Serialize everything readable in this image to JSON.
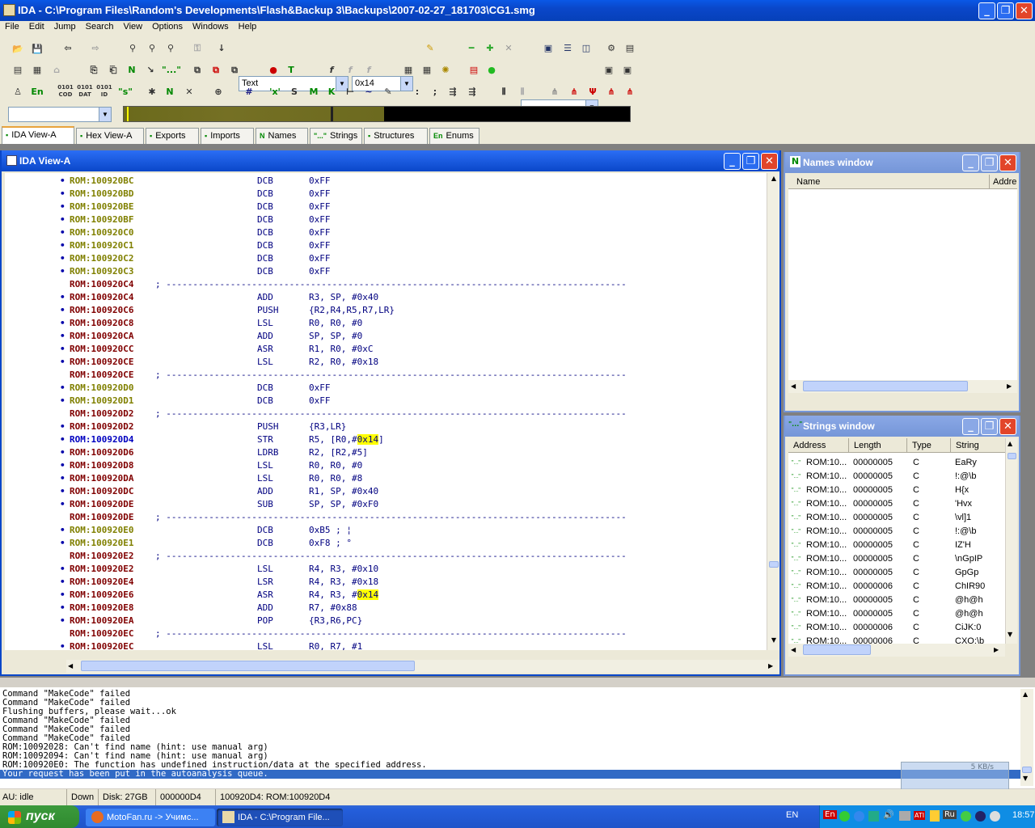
{
  "window": {
    "title": "IDA - C:\\Program Files\\Random's Developments\\Flash&Backup 3\\Backups\\2007-02-27_181703\\CG1.smg"
  },
  "menu": [
    "File",
    "Edit",
    "Jump",
    "Search",
    "View",
    "Options",
    "Windows",
    "Help"
  ],
  "toolbar": {
    "segment_type": "Text",
    "value_combo": "0x14",
    "row3": [
      "0101 COD",
      "0101 DAT",
      "0101 ID"
    ],
    "en_label": "En"
  },
  "tabs": [
    {
      "label": "IDA View-A",
      "icon": "ida-view-icon"
    },
    {
      "label": "Hex View-A",
      "icon": "hex-icon"
    },
    {
      "label": "Exports",
      "icon": "exports-icon"
    },
    {
      "label": "Imports",
      "icon": "imports-icon"
    },
    {
      "label": "Names",
      "icon": "N"
    },
    {
      "label": "Strings",
      "icon": "\"...\""
    },
    {
      "label": "Structures",
      "icon": "structures-icon"
    },
    {
      "label": "Enums",
      "icon": "En"
    }
  ],
  "ida_view": {
    "title": "IDA View-A",
    "lines": [
      {
        "addr": "ROM:100920BC",
        "color": "#808000",
        "dot": true,
        "mn": "DCB",
        "op": "0xFF"
      },
      {
        "addr": "ROM:100920BD",
        "color": "#808000",
        "dot": true,
        "mn": "DCB",
        "op": "0xFF"
      },
      {
        "addr": "ROM:100920BE",
        "color": "#808000",
        "dot": true,
        "mn": "DCB",
        "op": "0xFF"
      },
      {
        "addr": "ROM:100920BF",
        "color": "#808000",
        "dot": true,
        "mn": "DCB",
        "op": "0xFF"
      },
      {
        "addr": "ROM:100920C0",
        "color": "#808000",
        "dot": true,
        "mn": "DCB",
        "op": "0xFF"
      },
      {
        "addr": "ROM:100920C1",
        "color": "#808000",
        "dot": true,
        "mn": "DCB",
        "op": "0xFF"
      },
      {
        "addr": "ROM:100920C2",
        "color": "#808000",
        "dot": true,
        "mn": "DCB",
        "op": "0xFF"
      },
      {
        "addr": "ROM:100920C3",
        "color": "#808000",
        "dot": true,
        "mn": "DCB",
        "op": "0xFF"
      },
      {
        "addr": "ROM:100920C4",
        "color": "#800000",
        "sep": true
      },
      {
        "addr": "ROM:100920C4",
        "color": "#800000",
        "dot": true,
        "mn": "ADD",
        "op": "R3, SP, #0x40"
      },
      {
        "addr": "ROM:100920C6",
        "color": "#800000",
        "dot": true,
        "mn": "PUSH",
        "op": "{R2,R4,R5,R7,LR}"
      },
      {
        "addr": "ROM:100920C8",
        "color": "#800000",
        "dot": true,
        "mn": "LSL",
        "op": "R0, R0, #0"
      },
      {
        "addr": "ROM:100920CA",
        "color": "#800000",
        "dot": true,
        "mn": "ADD",
        "op": "SP, SP, #0"
      },
      {
        "addr": "ROM:100920CC",
        "color": "#800000",
        "dot": true,
        "mn": "ASR",
        "op": "R1, R0, #0xC"
      },
      {
        "addr": "ROM:100920CE",
        "color": "#800000",
        "dot": true,
        "mn": "LSL",
        "op": "R2, R0, #0x18"
      },
      {
        "addr": "ROM:100920CE",
        "color": "#800000",
        "sep": true
      },
      {
        "addr": "ROM:100920D0",
        "color": "#808000",
        "dot": true,
        "mn": "DCB",
        "op": "0xFF"
      },
      {
        "addr": "ROM:100920D1",
        "color": "#808000",
        "dot": true,
        "mn": "DCB",
        "op": "0xFF"
      },
      {
        "addr": "ROM:100920D2",
        "color": "#800000",
        "sep": true
      },
      {
        "addr": "ROM:100920D2",
        "color": "#800000",
        "dot": true,
        "mn": "PUSH",
        "op": "{R3,LR}"
      },
      {
        "addr": "ROM:100920D4",
        "color": "#0000c0",
        "dot": true,
        "mn": "STR",
        "op": "R5, [R0,#",
        "hl": "0x14",
        "post": "]"
      },
      {
        "addr": "ROM:100920D6",
        "color": "#800000",
        "dot": true,
        "mn": "LDRB",
        "op": "R2, [R2,#5]"
      },
      {
        "addr": "ROM:100920D8",
        "color": "#800000",
        "dot": true,
        "mn": "LSL",
        "op": "R0, R0, #0"
      },
      {
        "addr": "ROM:100920DA",
        "color": "#800000",
        "dot": true,
        "mn": "LSL",
        "op": "R0, R0, #8"
      },
      {
        "addr": "ROM:100920DC",
        "color": "#800000",
        "dot": true,
        "mn": "ADD",
        "op": "R1, SP, #0x40"
      },
      {
        "addr": "ROM:100920DE",
        "color": "#800000",
        "dot": true,
        "mn": "SUB",
        "op": "SP, SP, #0xF0"
      },
      {
        "addr": "ROM:100920DE",
        "color": "#800000",
        "sep": true
      },
      {
        "addr": "ROM:100920E0",
        "color": "#808000",
        "dot": true,
        "mn": "DCB",
        "op": "0xB5 ; ¦"
      },
      {
        "addr": "ROM:100920E1",
        "color": "#808000",
        "dot": true,
        "mn": "DCB",
        "op": "0xF8 ; °"
      },
      {
        "addr": "ROM:100920E2",
        "color": "#800000",
        "sep": true
      },
      {
        "addr": "ROM:100920E2",
        "color": "#800000",
        "dot": true,
        "mn": "LSL",
        "op": "R4, R3, #0x10"
      },
      {
        "addr": "ROM:100920E4",
        "color": "#800000",
        "dot": true,
        "mn": "LSR",
        "op": "R4, R3, #0x18"
      },
      {
        "addr": "ROM:100920E6",
        "color": "#800000",
        "dot": true,
        "mn": "ASR",
        "op": "R4, R3, #",
        "hl": "0x14",
        "post": ""
      },
      {
        "addr": "ROM:100920E8",
        "color": "#800000",
        "dot": true,
        "mn": "ADD",
        "op": "R7, #0x88"
      },
      {
        "addr": "ROM:100920EA",
        "color": "#800000",
        "dot": true,
        "mn": "POP",
        "op": "{R3,R6,PC}"
      },
      {
        "addr": "ROM:100920EC",
        "color": "#800000",
        "sep": true
      },
      {
        "addr": "ROM:100920EC",
        "color": "#800000",
        "dot": true,
        "mn": "LSL",
        "op": "R0, R7, #1"
      }
    ]
  },
  "names_window": {
    "title": "Names window",
    "columns": [
      "Name",
      "Addre"
    ]
  },
  "strings_window": {
    "title": "Strings window",
    "columns": [
      "Address",
      "Length",
      "Type",
      "String"
    ],
    "rows": [
      [
        "ROM:10...",
        "00000005",
        "C",
        "EaRy"
      ],
      [
        "ROM:10...",
        "00000005",
        "C",
        "!:@\\b"
      ],
      [
        "ROM:10...",
        "00000005",
        "C",
        "H{x"
      ],
      [
        "ROM:10...",
        "00000005",
        "C",
        "'Hvx"
      ],
      [
        "ROM:10...",
        "00000005",
        "C",
        "\\vl]1"
      ],
      [
        "ROM:10...",
        "00000005",
        "C",
        "!:@\\b"
      ],
      [
        "ROM:10...",
        "00000005",
        "C",
        "IZ'H"
      ],
      [
        "ROM:10...",
        "00000005",
        "C",
        "\\nGpIP"
      ],
      [
        "ROM:10...",
        "00000005",
        "C",
        "GpGp"
      ],
      [
        "ROM:10...",
        "00000006",
        "C",
        "ChIR90"
      ],
      [
        "ROM:10...",
        "00000005",
        "C",
        "@h@h"
      ],
      [
        "ROM:10...",
        "00000005",
        "C",
        "@h@h"
      ],
      [
        "ROM:10...",
        "00000006",
        "C",
        "CiJK:0"
      ],
      [
        "ROM:10...",
        "00000006",
        "C",
        "CXO:\\b"
      ]
    ]
  },
  "output": {
    "lines": [
      "Command \"MakeCode\" failed",
      "Command \"MakeCode\" failed",
      "Flushing buffers, please wait...ok",
      "Command \"MakeCode\" failed",
      "Command \"MakeCode\" failed",
      "Command \"MakeCode\" failed",
      "ROM:10092028: Can't find name (hint: use manual arg)",
      "ROM:10092094: Can't find name (hint: use manual arg)",
      "ROM:100920E0: The function has undefined instruction/data at the specified address.",
      "Your request has been put in the autoanalysis queue."
    ],
    "speed": "5 KB/s"
  },
  "status": {
    "au": "AU: idle",
    "dir": "Down",
    "disk": "Disk: 27GB",
    "offset": "000000D4",
    "location": "100920D4: ROM:100920D4"
  },
  "taskbar": {
    "start": "пуск",
    "tasks": [
      "MotoFan.ru -> Учимс...",
      "IDA - C:\\Program File..."
    ],
    "lang": "EN",
    "clock": "18:57",
    "tray_lang": [
      "En",
      "Ru"
    ]
  }
}
